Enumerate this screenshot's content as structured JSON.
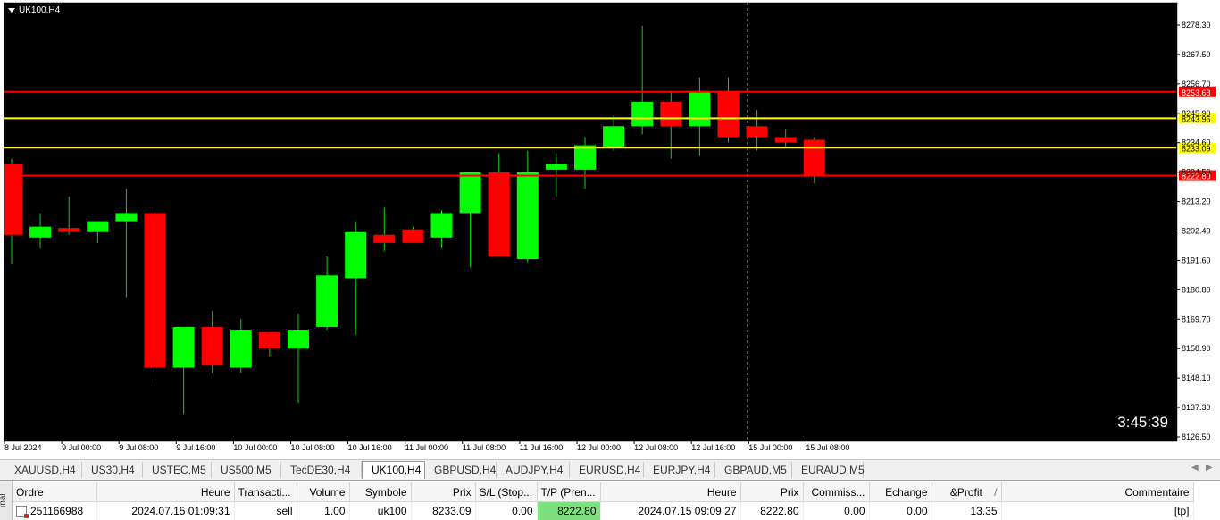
{
  "chart": {
    "symbol_title": "UK100,H4",
    "countdown": "3:45:39",
    "y_ticks": [
      "8278.30",
      "8267.50",
      "8256.70",
      "8245.90",
      "8234.60",
      "8224.50",
      "8213.20",
      "8202.40",
      "8191.60",
      "8180.80",
      "8169.70",
      "8158.90",
      "8148.10",
      "8137.30",
      "8126.50"
    ],
    "x_ticks": [
      "8 Jul 2024",
      "9 Jul 00:00",
      "9 Jul 08:00",
      "9 Jul 16:00",
      "10 Jul 00:00",
      "10 Jul 08:00",
      "10 Jul 16:00",
      "11 Jul 00:00",
      "11 Jul 08:00",
      "11 Jul 16:00",
      "12 Jul 00:00",
      "12 Jul 08:00",
      "12 Jul 16:00",
      "15 Jul 00:00",
      "15 Jul 08:00"
    ],
    "levels": [
      {
        "label": "8253.68",
        "color": "#ff0000"
      },
      {
        "label": "8243.95",
        "color": "#ffff00"
      },
      {
        "label": "8233.09",
        "color": "#ffff00"
      },
      {
        "label": "8222.80",
        "color": "#ff0000"
      }
    ],
    "colors": {
      "bull": "#00ff00",
      "bear": "#ff0000",
      "wick": "#00dd00",
      "background": "#000000"
    }
  },
  "chart_data": {
    "type": "candlestick",
    "ylim": [
      8126.5,
      8278.3
    ],
    "candles": [
      {
        "o": 8227.0,
        "h": 8229.0,
        "l": 8190.0,
        "c": 8201.0
      },
      {
        "o": 8200.0,
        "h": 8209.0,
        "l": 8196.0,
        "c": 8204.0
      },
      {
        "o": 8203.5,
        "h": 8215.0,
        "l": 8201.0,
        "c": 8202.0
      },
      {
        "o": 8202.0,
        "h": 8206.0,
        "l": 8198.0,
        "c": 8206.0
      },
      {
        "o": 8206.0,
        "h": 8218.0,
        "l": 8178.0,
        "c": 8209.0
      },
      {
        "o": 8209.0,
        "h": 8211.0,
        "l": 8146.0,
        "c": 8152.0
      },
      {
        "o": 8152.0,
        "h": 8167.0,
        "l": 8135.0,
        "c": 8167.0
      },
      {
        "o": 8167.0,
        "h": 8173.0,
        "l": 8150.0,
        "c": 8153.0
      },
      {
        "o": 8152.0,
        "h": 8170.0,
        "l": 8150.0,
        "c": 8166.0
      },
      {
        "o": 8165.0,
        "h": 8165.0,
        "l": 8156.0,
        "c": 8159.0
      },
      {
        "o": 8159.0,
        "h": 8172.0,
        "l": 8139.0,
        "c": 8166.0
      },
      {
        "o": 8167.0,
        "h": 8193.0,
        "l": 8166.0,
        "c": 8186.0
      },
      {
        "o": 8185.0,
        "h": 8206.0,
        "l": 8164.0,
        "c": 8202.0
      },
      {
        "o": 8201.0,
        "h": 8211.0,
        "l": 8195.0,
        "c": 8198.0
      },
      {
        "o": 8203.0,
        "h": 8204.0,
        "l": 8198.0,
        "c": 8198.0
      },
      {
        "o": 8200.0,
        "h": 8210.0,
        "l": 8196.0,
        "c": 8209.0
      },
      {
        "o": 8209.0,
        "h": 8224.0,
        "l": 8189.0,
        "c": 8224.0
      },
      {
        "o": 8224.0,
        "h": 8231.0,
        "l": 8193.0,
        "c": 8193.0
      },
      {
        "o": 8192.0,
        "h": 8232.0,
        "l": 8191.0,
        "c": 8224.0
      },
      {
        "o": 8225.0,
        "h": 8231.0,
        "l": 8215.0,
        "c": 8227.0
      },
      {
        "o": 8225.0,
        "h": 8237.0,
        "l": 8218.0,
        "c": 8234.0
      },
      {
        "o": 8233.0,
        "h": 8245.0,
        "l": 8232.0,
        "c": 8241.0
      },
      {
        "o": 8241.0,
        "h": 8278.0,
        "l": 8238.0,
        "c": 8250.0
      },
      {
        "o": 8250.0,
        "h": 8254.0,
        "l": 8229.0,
        "c": 8241.0
      },
      {
        "o": 8241.0,
        "h": 8259.0,
        "l": 8230.0,
        "c": 8254.0
      },
      {
        "o": 8254.0,
        "h": 8259.0,
        "l": 8235.0,
        "c": 8237.0
      },
      {
        "o": 8241.0,
        "h": 8247.0,
        "l": 8232.0,
        "c": 8237.0
      },
      {
        "o": 8237.0,
        "h": 8240.0,
        "l": 8233.0,
        "c": 8235.0
      },
      {
        "o": 8236.0,
        "h": 8237.0,
        "l": 8220.0,
        "c": 8223.0
      }
    ],
    "levels": [
      8253.68,
      8243.95,
      8233.09,
      8222.8
    ]
  },
  "tabs": {
    "items": [
      "XAUUSD,H4",
      "US30,H4",
      "USTEC,M5",
      "US500,M5",
      "TecDE30,H4",
      "UK100,H4",
      "GBPUSD,H4",
      "AUDJPY,H4",
      "EURUSD,H4",
      "EURJPY,H4",
      "GBPAUD,M5",
      "EURAUD,M5"
    ],
    "active": "UK100,H4"
  },
  "terminal": {
    "side_label": "inal",
    "columns": [
      "Ordre",
      "Heure",
      "Transacti...",
      "Volume",
      "Symbole",
      "Prix",
      "S/L (Stop...",
      "T/P (Pren...",
      "Heure",
      "Prix",
      "Commiss...",
      "Echange",
      "&Profit",
      "Commentaire"
    ],
    "sort_marker": "/",
    "rows": [
      {
        "order": "251166988",
        "time": "2024.07.15 01:09:31",
        "type": "sell",
        "volume": "1.00",
        "symbol": "uk100",
        "price": "8233.09",
        "sl": "0.00",
        "tp": "8222.80",
        "close_time": "2024.07.15 09:09:27",
        "close_price": "8222.80",
        "commission": "0.00",
        "swap": "0.00",
        "profit": "13.35",
        "comment": "[tp]"
      }
    ]
  }
}
